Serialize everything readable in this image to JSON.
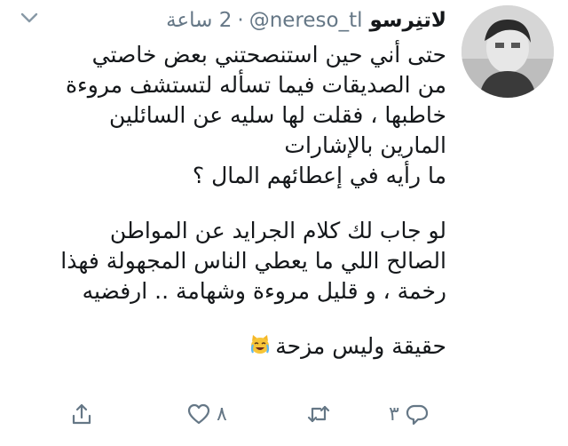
{
  "tweet": {
    "author_name": "لاتنِرسو",
    "author_handle": "@nereso_tl",
    "separator": "·",
    "time": "2 ساعة",
    "lines": [
      "حتى أني حين استنصحتني بعض خاصتي",
      "من الصديقات فيما تسأله لتستشف مروءة",
      "خاطبها ، فقلت لها سليه عن السائلين",
      "المارين بالإشارات",
      "ما رأيه في إعطائهم المال ؟",
      "لو جاب لك كلام الجرايد عن المواطن",
      "الصالح اللي ما يعطي الناس المجهولة فهذا",
      "رخمة ، و قليل مروءة وشهامة .. ارفضيه",
      "حقيقة وليس مزحة"
    ],
    "emoji": "face-with-tears-of-joy-cat-icon"
  },
  "actions": {
    "reply_count": "٣",
    "retweet_count": "",
    "like_count": "٨",
    "icons": [
      "reply-icon",
      "retweet-icon",
      "like-icon",
      "share-icon"
    ]
  },
  "colors": {
    "text": "#14171a",
    "secondary": "#657786"
  }
}
